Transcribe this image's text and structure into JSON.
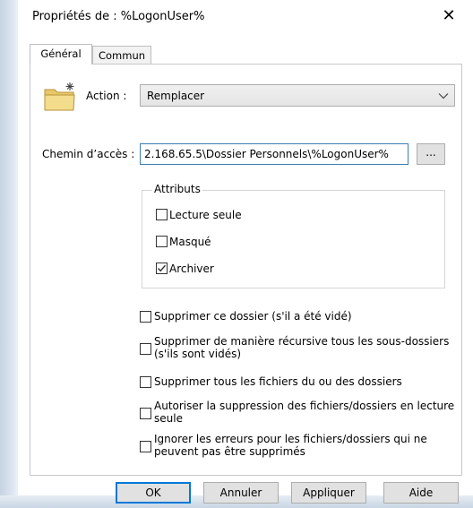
{
  "window": {
    "title": "Propriétés de : %LogonUser%",
    "close_symbol": "✕"
  },
  "tabs": [
    {
      "label": "Général",
      "active": true
    },
    {
      "label": "Commun",
      "active": false
    }
  ],
  "action": {
    "label": "Action :",
    "value": "Remplacer",
    "icon": "new-folder-icon"
  },
  "path": {
    "label": "Chemin d’accès :",
    "value": "2.168.65.5\\Dossier Personnels\\%LogonUser%",
    "browse_label": "..."
  },
  "attributes": {
    "title": "Attributs",
    "items": [
      {
        "label": "Lecture seule",
        "checked": false
      },
      {
        "label": "Masqué",
        "checked": false
      },
      {
        "label": "Archiver",
        "checked": true
      }
    ]
  },
  "options": [
    {
      "line1": "Supprimer ce dossier (s'il a été vidé)",
      "line2": "",
      "checked": false
    },
    {
      "line1": "Supprimer de manière récursive tous les sous-dossiers",
      "line2": "(s'ils sont vidés)",
      "checked": false
    },
    {
      "line1": "Supprimer tous les fichiers du ou des dossiers",
      "line2": "",
      "checked": false
    },
    {
      "line1": "Autoriser la suppression des fichiers/dossiers en lecture",
      "line2": "seule",
      "checked": false
    },
    {
      "line1": "Ignorer les erreurs pour les fichiers/dossiers qui ne",
      "line2": "peuvent pas être supprimés",
      "checked": false
    }
  ],
  "buttons": {
    "ok": "OK",
    "cancel": "Annuler",
    "apply": "Appliquer",
    "help": "Aide"
  },
  "colors": {
    "focus_border": "#3c7fb1",
    "default_button": "#0078d7"
  }
}
